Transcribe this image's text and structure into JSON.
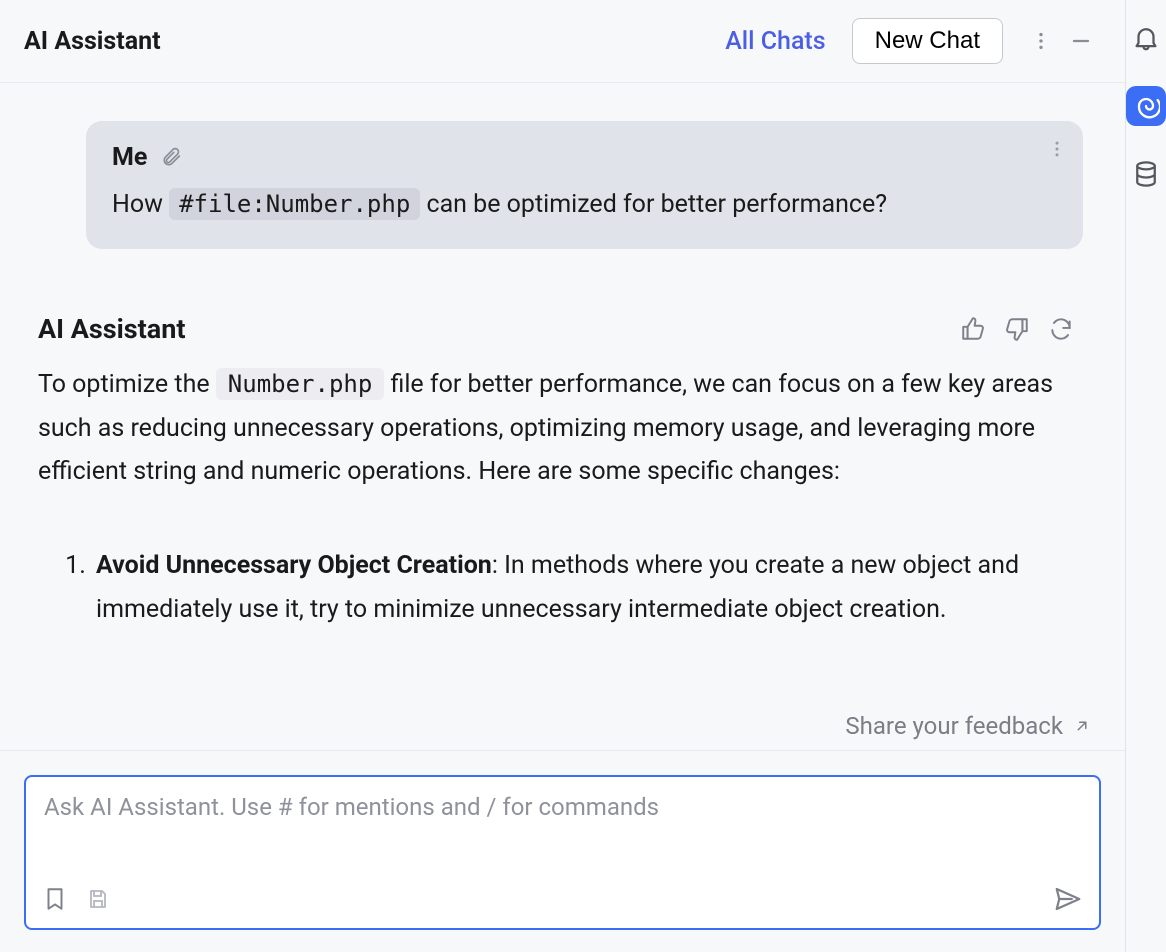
{
  "header": {
    "title": "AI Assistant",
    "all_chats": "All Chats",
    "new_chat": "New Chat"
  },
  "user_message": {
    "sender": "Me",
    "before_chip": "How ",
    "chip": "#file:Number.php",
    "after_chip": " can be optimized for better performance?"
  },
  "assistant": {
    "name": "AI Assistant",
    "intro_before_code": "To optimize the ",
    "intro_code": "Number.php",
    "intro_after_code": " file for better performance, we can focus on a few key areas such as reducing unnecessary operations, optimizing memory usage, and leveraging more efficient string and numeric operations. Here are some specific changes:",
    "points": [
      {
        "title": "Avoid Unnecessary Object Creation",
        "body": ": In methods where you create a new object and immediately use it, try to minimize unnecessary intermediate object creation."
      }
    ]
  },
  "feedback_label": "Share your feedback",
  "input": {
    "placeholder": "Ask AI Assistant. Use # for mentions and / for commands"
  }
}
